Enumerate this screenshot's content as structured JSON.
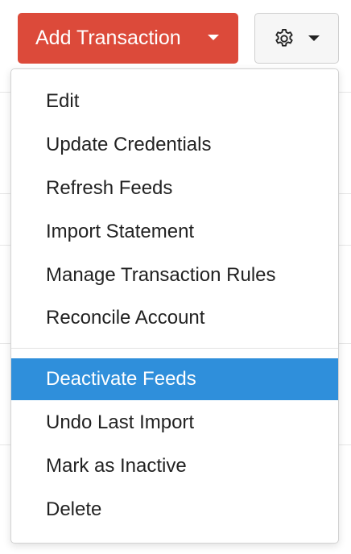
{
  "toolbar": {
    "add_transaction_label": "Add Transaction",
    "accent_color": "#dc4a3a",
    "settings_icon": "gear-icon"
  },
  "menu": {
    "items": [
      {
        "label": "Edit"
      },
      {
        "label": "Update Credentials"
      },
      {
        "label": "Refresh Feeds"
      },
      {
        "label": "Import Statement"
      },
      {
        "label": "Manage Transaction Rules"
      },
      {
        "label": "Reconcile Account"
      },
      {
        "label": "Deactivate Feeds",
        "highlighted": true
      },
      {
        "label": "Undo Last Import"
      },
      {
        "label": "Mark as Inactive"
      },
      {
        "label": "Delete"
      }
    ],
    "highlight_color": "#2f8fdb"
  }
}
